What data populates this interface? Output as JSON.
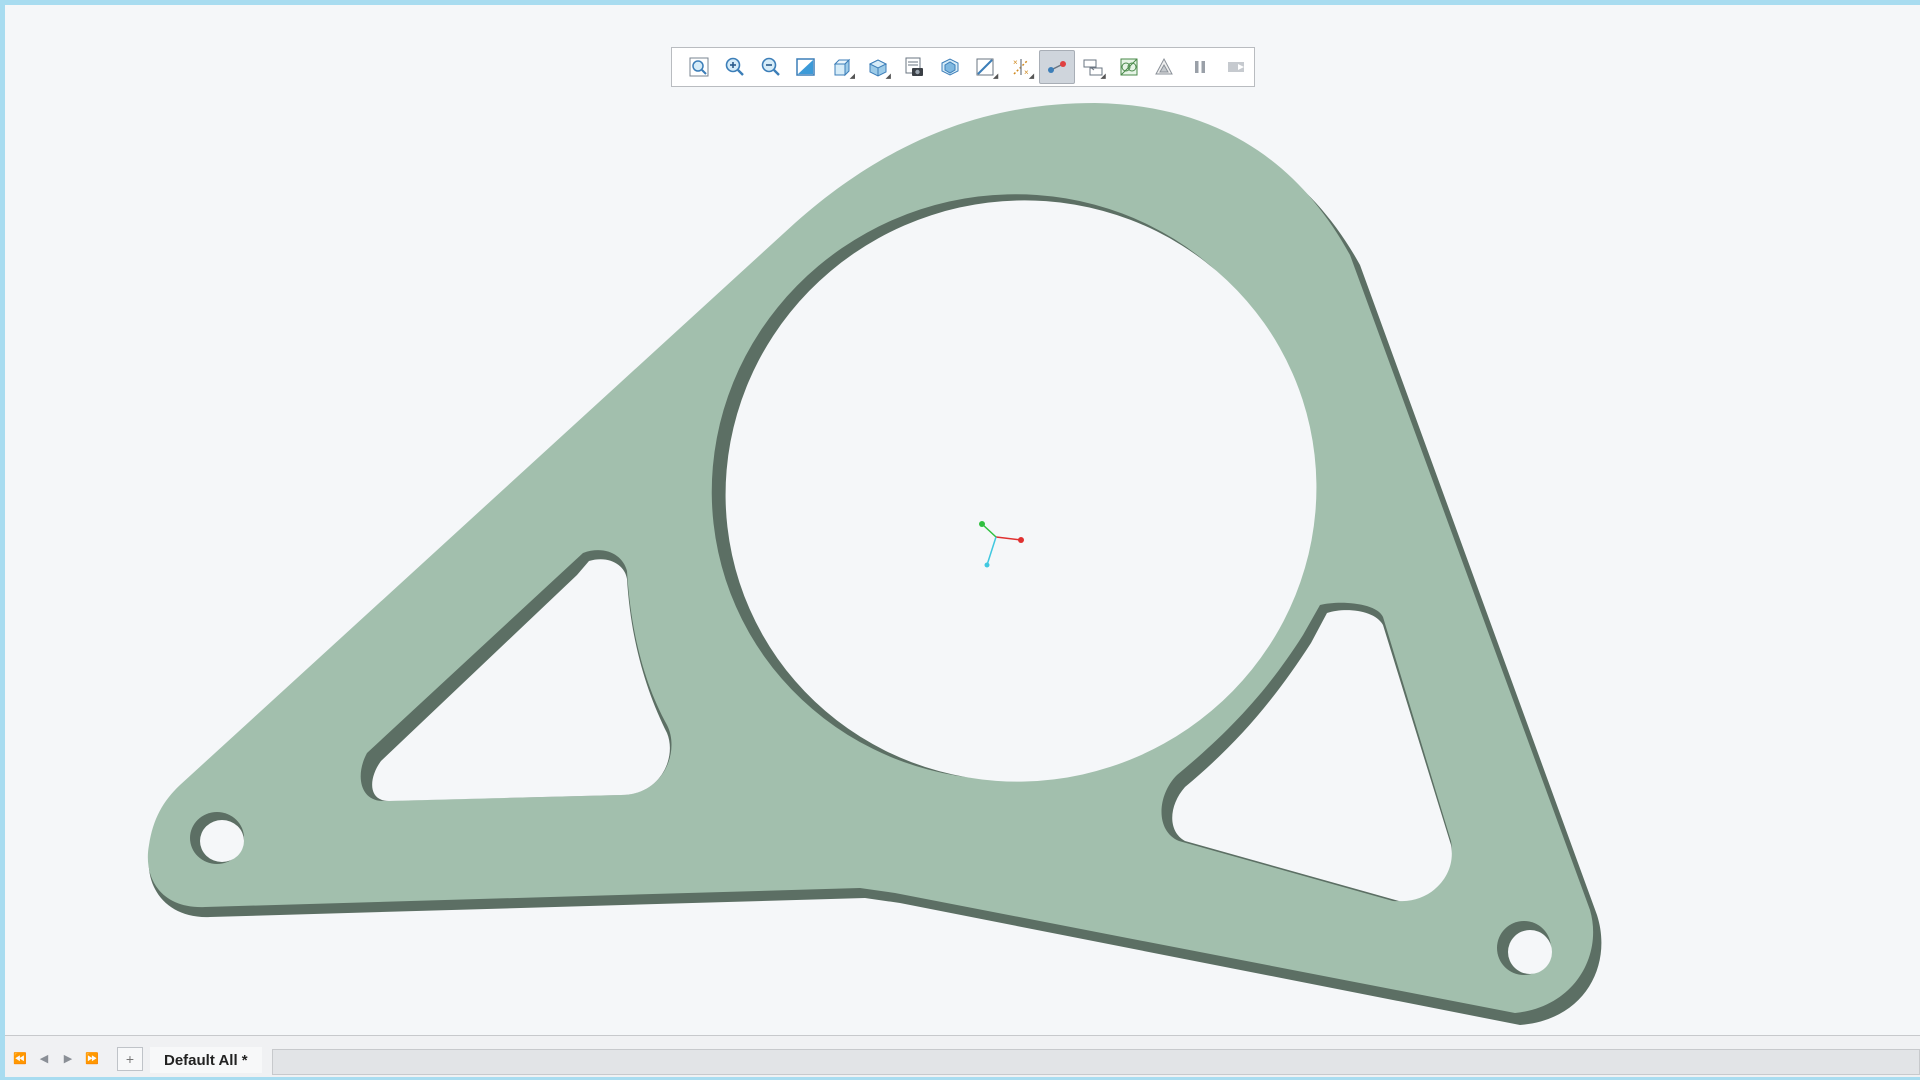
{
  "toolbar": {
    "buttons": [
      {
        "icon": "zoom-fit-icon",
        "dropdown": false,
        "active": false
      },
      {
        "icon": "zoom-in-icon",
        "dropdown": false,
        "active": false
      },
      {
        "icon": "zoom-out-icon",
        "dropdown": false,
        "active": false
      },
      {
        "icon": "repaint-icon",
        "dropdown": false,
        "active": false
      },
      {
        "icon": "saved-orientations-icon",
        "dropdown": true,
        "active": false
      },
      {
        "icon": "display-style-icon",
        "dropdown": true,
        "active": false
      },
      {
        "icon": "view-manager-icon",
        "dropdown": false,
        "active": false
      },
      {
        "icon": "perspective-icon",
        "dropdown": false,
        "active": false
      },
      {
        "icon": "section-icon",
        "dropdown": true,
        "active": false
      },
      {
        "icon": "datum-display-icon",
        "dropdown": true,
        "active": false
      },
      {
        "icon": "spin-center-icon",
        "dropdown": false,
        "active": true
      },
      {
        "icon": "annotation-display-icon",
        "dropdown": true,
        "active": false
      },
      {
        "icon": "appearance-icon",
        "dropdown": false,
        "active": false
      },
      {
        "icon": "simulation-icon",
        "dropdown": false,
        "active": false
      },
      {
        "icon": "pause-icon",
        "dropdown": false,
        "active": false
      },
      {
        "icon": "play-icon",
        "dropdown": false,
        "active": false
      }
    ]
  },
  "colors": {
    "part_face": "#a2bfad",
    "part_edge": "#5c6f64",
    "background": "#f5f7f9",
    "axis_x": "#e03030",
    "axis_y": "#30c040",
    "axis_z": "#40c8e0",
    "window_border": "#a8dcf0"
  },
  "bottom_bar": {
    "nav_icons": [
      "first-page-icon",
      "prev-page-icon",
      "next-page-icon",
      "last-page-icon"
    ],
    "add_tab_label": "+",
    "active_sheet": "Default All *"
  }
}
